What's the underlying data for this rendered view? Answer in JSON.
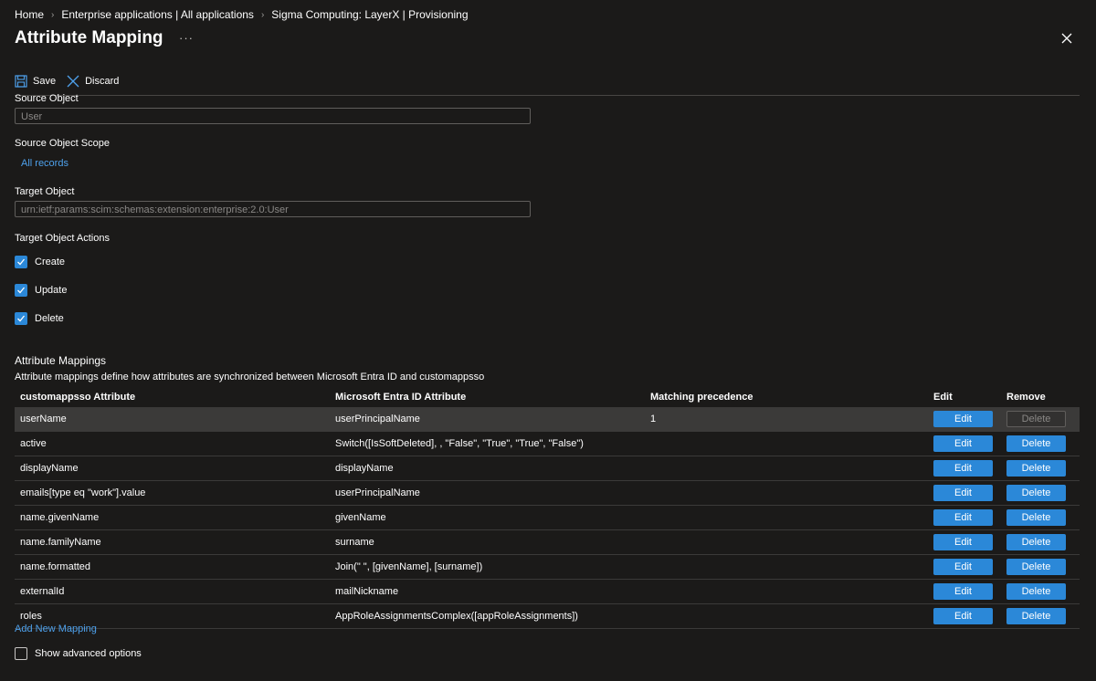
{
  "breadcrumb": [
    "Home",
    "Enterprise applications | All applications",
    "Sigma Computing: LayerX | Provisioning"
  ],
  "title": "Attribute Mapping",
  "more_label": "···",
  "toolbar": {
    "save_label": "Save",
    "discard_label": "Discard"
  },
  "source_object": {
    "label": "Source Object",
    "value": "User"
  },
  "source_scope": {
    "label": "Source Object Scope",
    "link": "All records"
  },
  "target_object": {
    "label": "Target Object",
    "value": "urn:ietf:params:scim:schemas:extension:enterprise:2.0:User"
  },
  "target_actions": {
    "label": "Target Object Actions",
    "items": [
      {
        "label": "Create",
        "checked": true
      },
      {
        "label": "Update",
        "checked": true
      },
      {
        "label": "Delete",
        "checked": true
      }
    ]
  },
  "mappings": {
    "title": "Attribute Mappings",
    "description": "Attribute mappings define how attributes are synchronized between Microsoft Entra ID and customappsso",
    "headers": [
      "customappsso Attribute",
      "Microsoft Entra ID Attribute",
      "Matching precedence",
      "Edit",
      "Remove"
    ],
    "edit_label": "Edit",
    "delete_label": "Delete",
    "rows": [
      {
        "target": "userName",
        "source": "userPrincipalName",
        "precedence": "1"
      },
      {
        "target": "active",
        "source": "Switch([IsSoftDeleted], , \"False\", \"True\", \"True\", \"False\")",
        "precedence": ""
      },
      {
        "target": "displayName",
        "source": "displayName",
        "precedence": ""
      },
      {
        "target": "emails[type eq \"work\"].value",
        "source": "userPrincipalName",
        "precedence": ""
      },
      {
        "target": "name.givenName",
        "source": "givenName",
        "precedence": ""
      },
      {
        "target": "name.familyName",
        "source": "surname",
        "precedence": ""
      },
      {
        "target": "name.formatted",
        "source": "Join(\" \", [givenName], [surname])",
        "precedence": ""
      },
      {
        "target": "externalId",
        "source": "mailNickname",
        "precedence": ""
      },
      {
        "target": "roles",
        "source": "AppRoleAssignmentsComplex([appRoleAssignments])",
        "precedence": ""
      }
    ],
    "add_link": "Add New Mapping"
  },
  "advanced": {
    "label": "Show advanced options",
    "checked": false
  },
  "colors": {
    "background": "#1b1a19",
    "accent": "#2b88d8",
    "link": "#4ea1ec",
    "selected_row": "#3b3a39"
  }
}
